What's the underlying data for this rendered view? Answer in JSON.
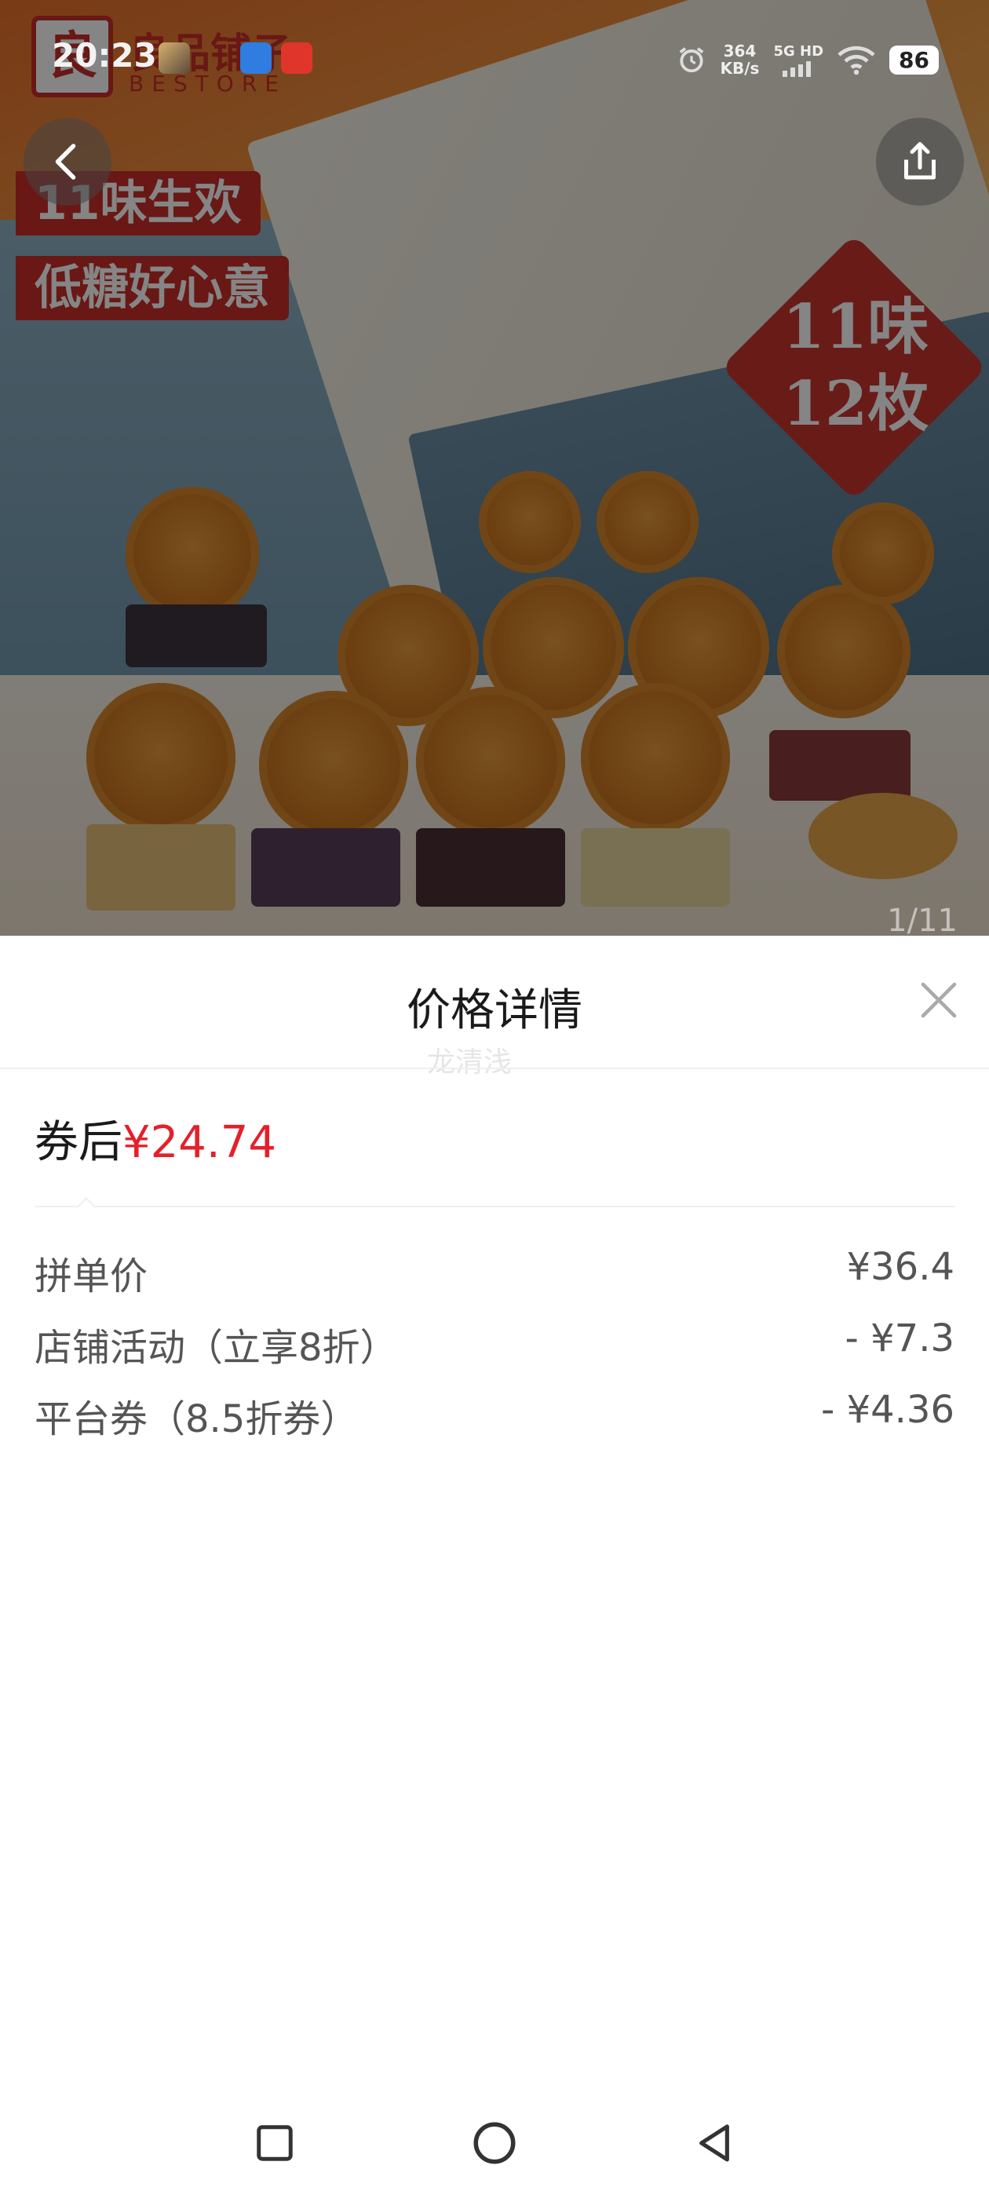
{
  "status_bar": {
    "time": "20:23",
    "speed_value": "364",
    "speed_unit": "KB/s",
    "network": "5G HD",
    "battery": "86"
  },
  "hero": {
    "brand_name": "良品铺子",
    "brand_sub": "BESTORE",
    "slogan_1": "11味生欢",
    "slogan_2": "低糖好心意",
    "badge_line_1": "11味",
    "badge_line_2": "12枚",
    "pager": "1/11",
    "back_icon": "chevron-left-icon",
    "share_icon": "share-icon"
  },
  "sheet": {
    "title": "价格详情",
    "watermark": "龙清浅",
    "final_label": "券后",
    "final_price": "¥24.74",
    "items": [
      {
        "label": "拼单价",
        "value": "¥36.4"
      },
      {
        "label": "店铺活动（立享8折）",
        "value": "- ¥7.3"
      },
      {
        "label": "平台券（8.5折券）",
        "value": "- ¥4.36"
      }
    ],
    "close_icon": "close-icon"
  },
  "navbar": {
    "recent_icon": "square-icon",
    "home_icon": "circle-icon",
    "back_icon": "triangle-back-icon"
  },
  "colors": {
    "accent_red": "#e5202a",
    "brand_red": "#c92f2a"
  }
}
